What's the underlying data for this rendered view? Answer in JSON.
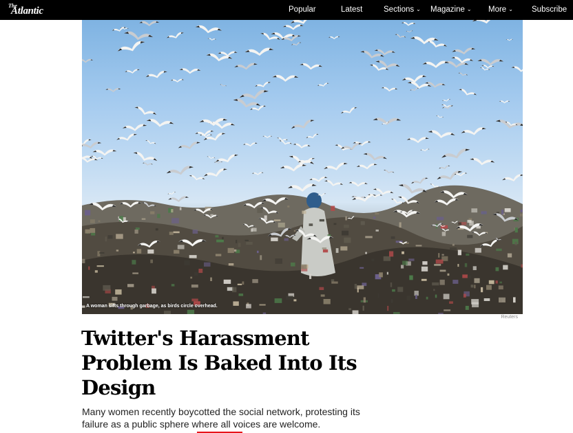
{
  "brand": {
    "logo_the": "The",
    "logo_name": "Atlantic"
  },
  "nav": {
    "items": [
      {
        "label": "Popular",
        "dropdown": false
      },
      {
        "label": "Latest",
        "dropdown": false
      },
      {
        "label": "Sections",
        "dropdown": true
      },
      {
        "label": "Magazine",
        "dropdown": true
      },
      {
        "label": "More",
        "dropdown": true
      },
      {
        "label": "Subscribe",
        "dropdown": false
      }
    ],
    "chevron": "⌄"
  },
  "article": {
    "image_caption": "A woman sifts through garbage, as birds circle overhead.",
    "image_credit": "Reuters",
    "headline": "Twitter's Harassment Problem Is Baked Into Its Design",
    "dek": "Many women recently boycotted the social network, protesting its failure as a public sphere where all voices are welcome."
  },
  "colors": {
    "navbar_bg": "#000000",
    "nav_text": "#ffffff",
    "accent_rule": "#e7131a",
    "sky": "#a5cbef"
  },
  "icons": [
    "chevron-down-icon"
  ]
}
